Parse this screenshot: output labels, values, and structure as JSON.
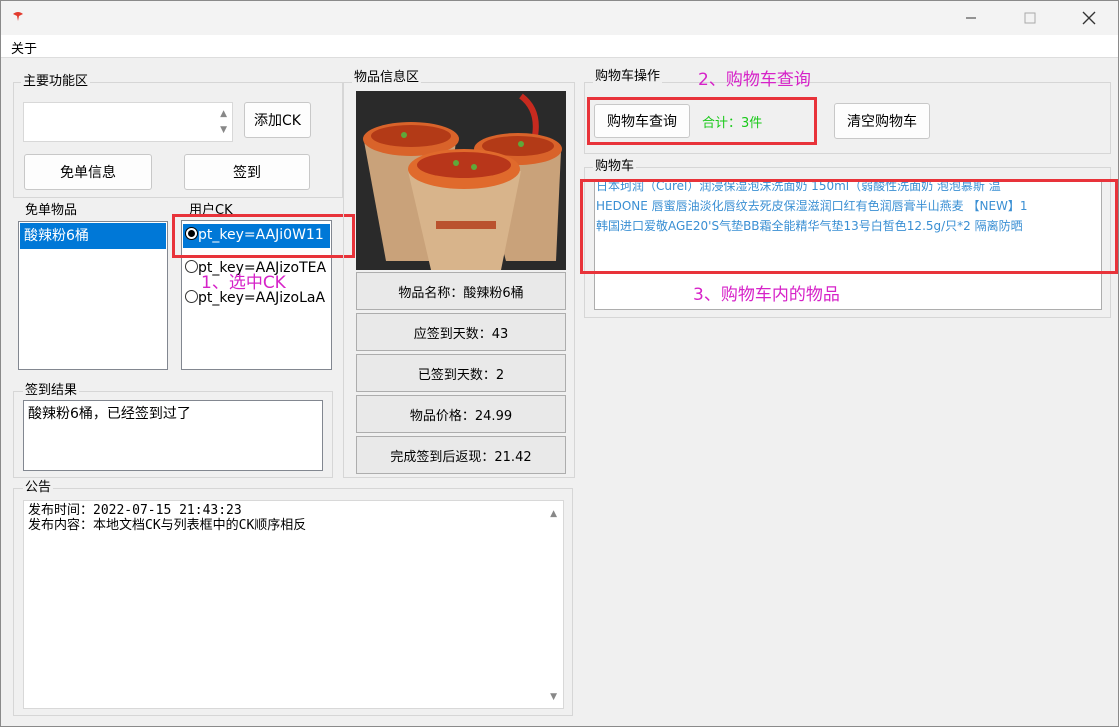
{
  "menu": {
    "about": "关于"
  },
  "main_group": {
    "label": "主要功能区",
    "add_ck_label": "添加CK",
    "free_info_label": "免单信息",
    "sign_label": "签到"
  },
  "free_items": {
    "label": "免单物品",
    "items": [
      "酸辣粉6桶"
    ]
  },
  "user_ck": {
    "label": "用户CK",
    "items": [
      "pt_key=AAJi0W11",
      "pt_key=AAJizoTEA",
      "pt_key=AAJizoLaA"
    ]
  },
  "sign_result": {
    "label": "签到结果",
    "text": "酸辣粉6桶，已经签到过了"
  },
  "notice": {
    "label": "公告",
    "line1": "发布时间：2022-07-15 21:43:23",
    "line2": "发布内容：本地文档CK与列表框中的CK顺序相反"
  },
  "item_info": {
    "label": "物品信息区",
    "name": "物品名称：酸辣粉6桶",
    "should_days": "应签到天数：43",
    "signed_days": "已签到天数：2",
    "price": "物品价格：24.99",
    "cashback": "完成签到后返现：21.42"
  },
  "cart_ops": {
    "label": "购物车操作",
    "query_label": "购物车查询",
    "total": "合计：3件",
    "clear_label": "清空购物车"
  },
  "cart": {
    "label": "购物车",
    "items": [
      "日本珂润（Curel）润浸保湿泡沫洗面奶 150ml（弱酸性洗面奶 泡泡慕斯 温",
      "HEDONE 唇蜜唇油淡化唇纹去死皮保湿滋润口红有色润唇膏半山燕麦 【NEW】1",
      "韩国进口爱敬AGE20'S气垫BB霜全能精华气垫13号白皙色12.5g/只*2 隔离防晒"
    ]
  },
  "annotations": {
    "select_ck": "1、选中CK",
    "cart_query": "2、购物车查询",
    "cart_items": "3、购物车内的物品"
  },
  "colors": {
    "total_green": "#19c919",
    "annotation_magenta": "#d622c8",
    "highlight_red": "#e8333a",
    "selection_blue": "#0078d7"
  }
}
